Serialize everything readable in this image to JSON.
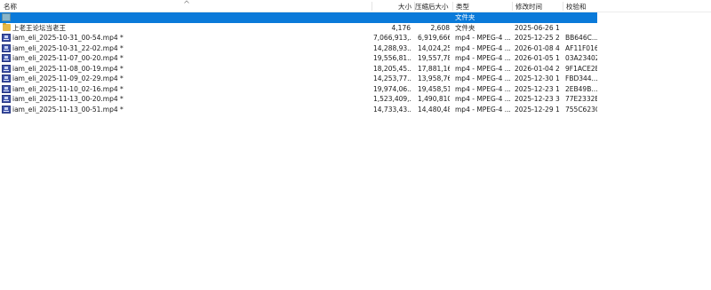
{
  "columns": {
    "name": "名称",
    "size": "大小",
    "packed": "压缩后大小",
    "type": "类型",
    "modified": "修改时间",
    "crc": "校验和"
  },
  "parent_row": {
    "type": "文件夹"
  },
  "rows": [
    {
      "name": "上老王论坛当老王",
      "size": "4,176",
      "packed": "2,608",
      "type": "文件夹",
      "modified": "2025-06-26 1",
      "crc": "",
      "icon": "folder-icon"
    },
    {
      "name": "iam_eli_2025-10-31_00-54.mp4 *",
      "size": "7,066,913,...",
      "packed": "6,919,666,...",
      "type": "mp4 - MPEG-4 ...",
      "modified": "2025-12-25 2",
      "crc": "BB646C...",
      "icon": "video-file-icon"
    },
    {
      "name": "iam_eli_2025-10-31_22-02.mp4 *",
      "size": "14,288,93...",
      "packed": "14,024,25...",
      "type": "mp4 - MPEG-4 ...",
      "modified": "2026-01-08 4",
      "crc": "AF11F016",
      "icon": "video-file-icon"
    },
    {
      "name": "iam_eli_2025-11-07_00-20.mp4 *",
      "size": "19,556,81...",
      "packed": "19,557,78...",
      "type": "mp4 - MPEG-4 ...",
      "modified": "2026-01-05 1",
      "crc": "03A23402",
      "icon": "video-file-icon"
    },
    {
      "name": "iam_eli_2025-11-08_00-19.mp4 *",
      "size": "18,205,45...",
      "packed": "17,881,16...",
      "type": "mp4 - MPEG-4 ...",
      "modified": "2026-01-04 2",
      "crc": "9F1ACE2B",
      "icon": "video-file-icon"
    },
    {
      "name": "iam_eli_2025-11-09_02-29.mp4 *",
      "size": "14,253,77...",
      "packed": "13,958,76...",
      "type": "mp4 - MPEG-4 ...",
      "modified": "2025-12-30 1",
      "crc": "FBD344...",
      "icon": "video-file-icon"
    },
    {
      "name": "iam_eli_2025-11-10_02-16.mp4 *",
      "size": "19,974,06...",
      "packed": "19,458,51...",
      "type": "mp4 - MPEG-4 ...",
      "modified": "2025-12-23 1",
      "crc": "2EB49B...",
      "icon": "video-file-icon"
    },
    {
      "name": "iam_eli_2025-11-13_00-20.mp4 *",
      "size": "1,523,409,...",
      "packed": "1,490,810,...",
      "type": "mp4 - MPEG-4 ...",
      "modified": "2025-12-23 3",
      "crc": "77E2332E",
      "icon": "video-file-icon"
    },
    {
      "name": "iam_eli_2025-11-13_00-51.mp4 *",
      "size": "14,733,43...",
      "packed": "14,480,48...",
      "type": "mp4 - MPEG-4 ...",
      "modified": "2025-12-29 1",
      "crc": "755C623C",
      "icon": "video-file-icon"
    }
  ]
}
